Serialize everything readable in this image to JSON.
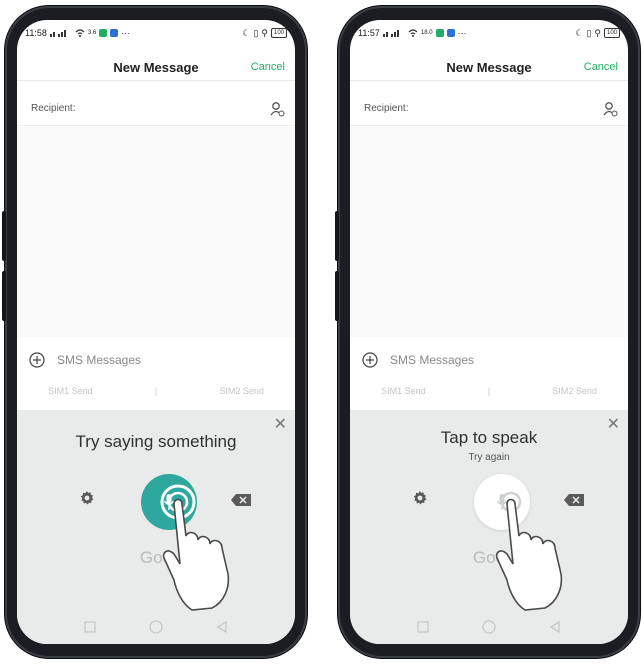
{
  "left": {
    "status": {
      "time": "11:58",
      "net_speed": "3.6",
      "battery": "100"
    },
    "nav": {
      "title": "New Message",
      "cancel": "Cancel"
    },
    "recipient_label": "Recipient:",
    "sms_label": "SMS Messages",
    "sim": {
      "sim1": "SIM1 Send",
      "divider": "|",
      "sim2": "SIM2 Send"
    },
    "voice": {
      "title": "Try saying something",
      "subtitle": "",
      "mic_state": "listening",
      "mic_color": "#2ea89e"
    },
    "google_text": "Goo"
  },
  "right": {
    "status": {
      "time": "11:57",
      "net_speed": "18.0",
      "battery": "100"
    },
    "nav": {
      "title": "New Message",
      "cancel": "Cancel"
    },
    "recipient_label": "Recipient:",
    "sms_label": "SMS Messages",
    "sim": {
      "sim1": "SIM1 Send",
      "divider": "|",
      "sim2": "SIM2 Send"
    },
    "voice": {
      "title": "Tap to speak",
      "subtitle": "Try again",
      "mic_state": "idle",
      "mic_color": "#ffffff"
    },
    "google_text": "Goo"
  },
  "colors": {
    "accent": "#1fae63",
    "mic_teal": "#2ea89e",
    "panel": "#e9ebeb"
  },
  "icons": [
    "signal-icon",
    "wifi-icon",
    "add-contact-icon",
    "plus-circle-icon",
    "close-icon",
    "gear-icon",
    "mic-icon",
    "backspace-icon",
    "nav-square-icon",
    "nav-home-icon",
    "nav-back-icon"
  ]
}
